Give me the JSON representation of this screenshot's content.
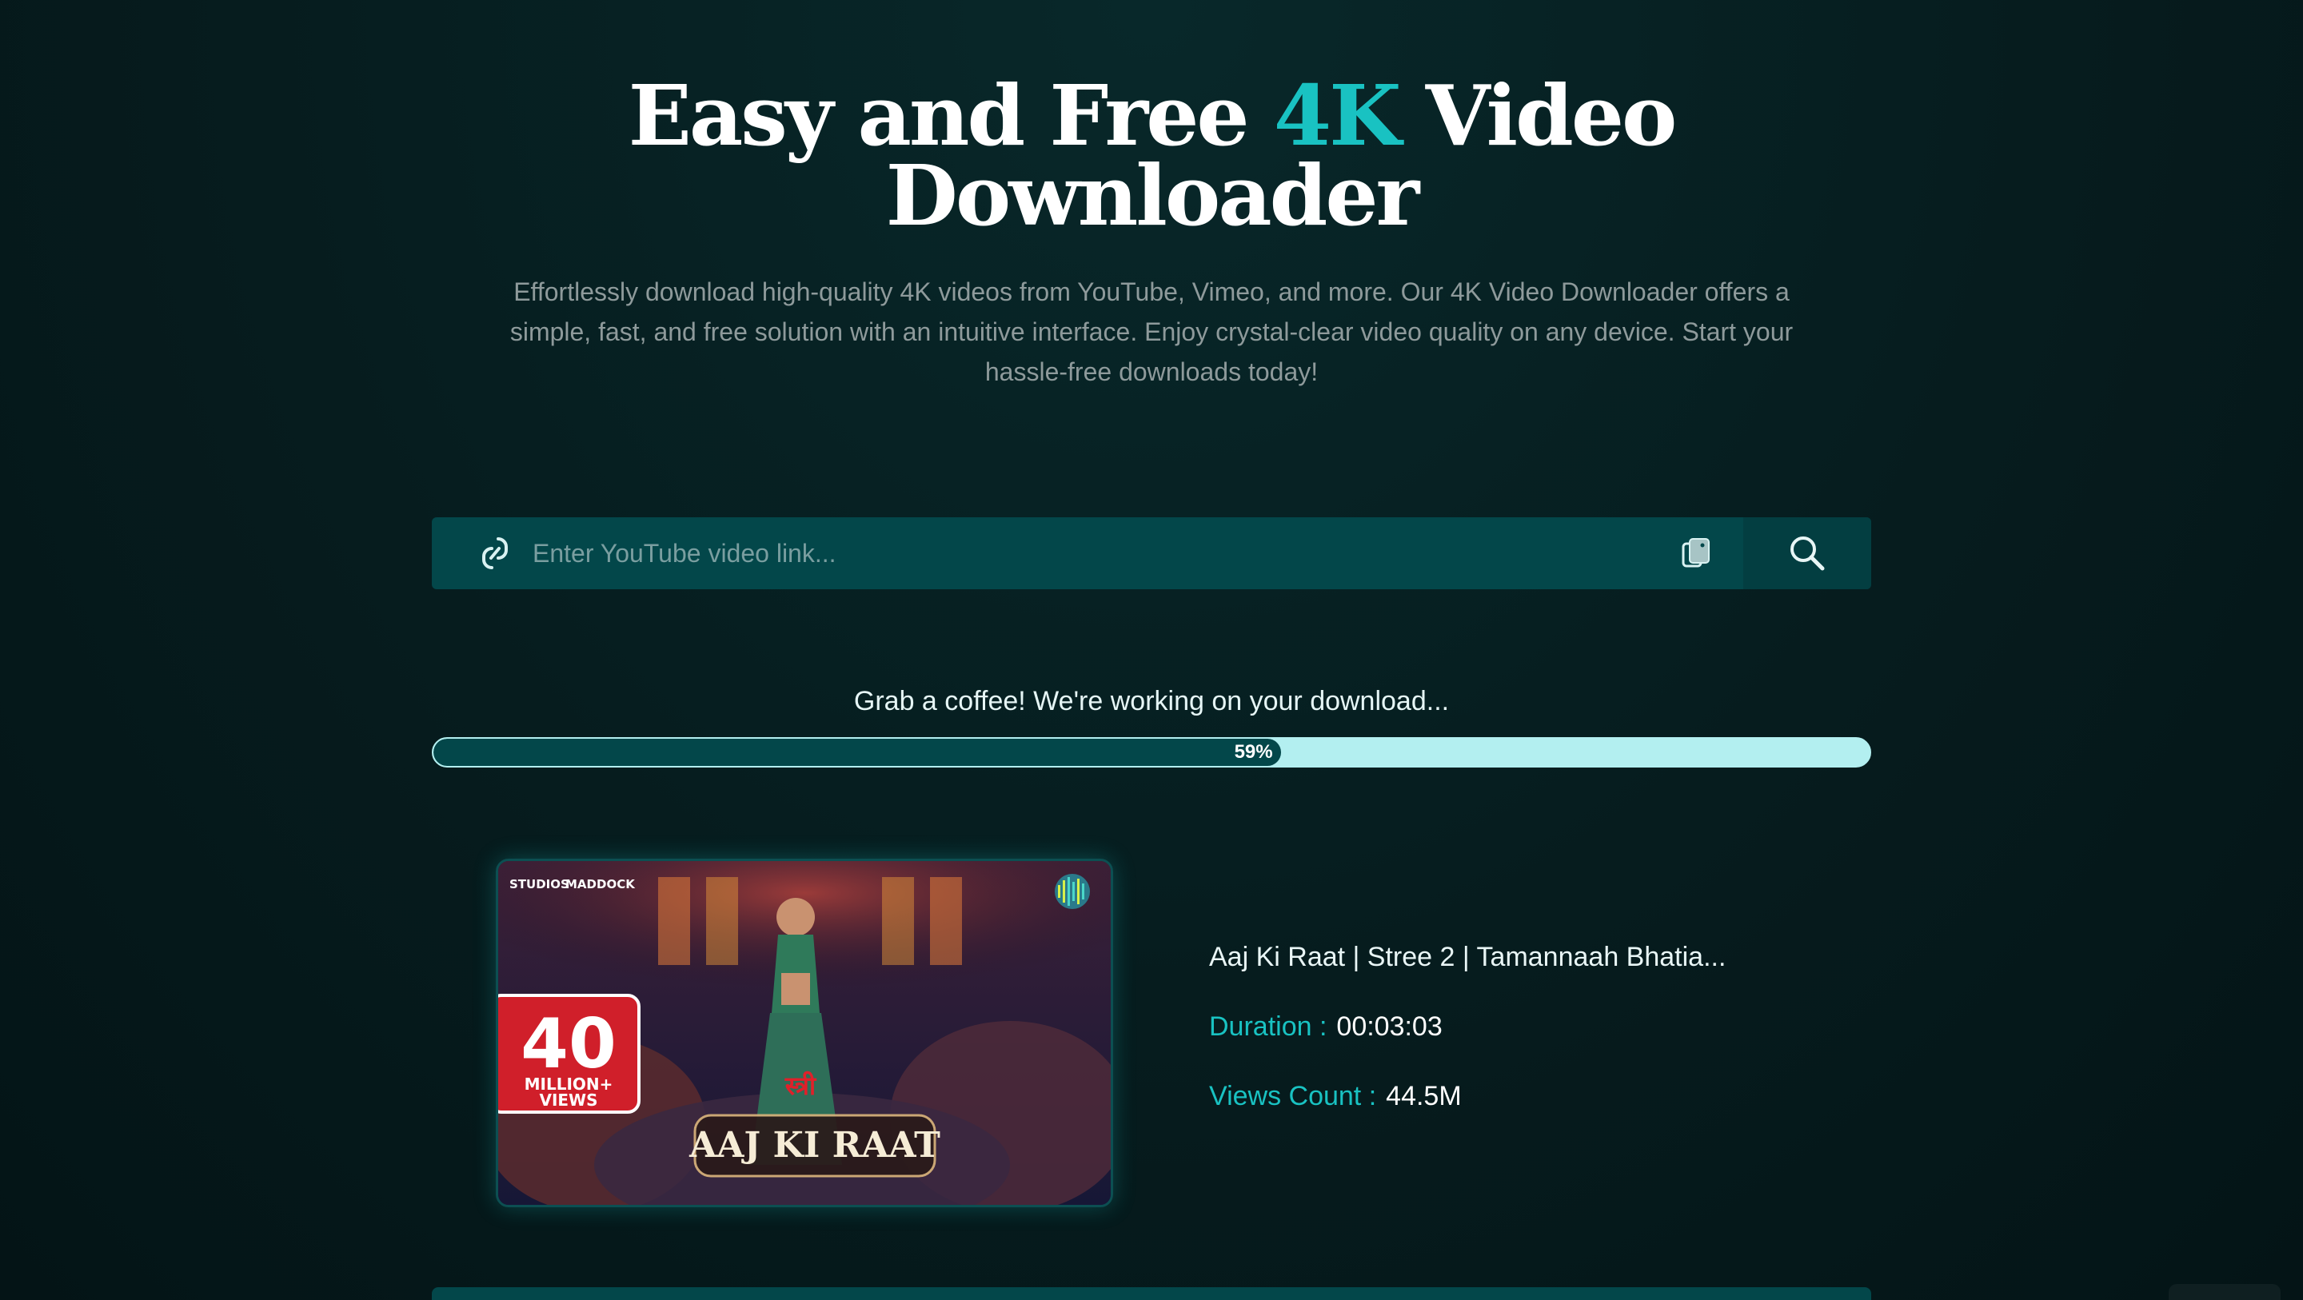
{
  "hero": {
    "title_part1": "Easy and Free ",
    "title_accent": "4K",
    "title_part2": " Video",
    "title_line2": "Downloader",
    "description": "Effortlessly download high-quality 4K videos from YouTube, Vimeo, and more. Our 4K Video Downloader offers a simple, fast, and free solution with an intuitive interface. Enjoy crystal-clear video quality on any device. Start your hassle-free downloads today!"
  },
  "search": {
    "placeholder": "Enter YouTube video link...",
    "value": "",
    "link_icon": "link-icon",
    "paste_icon": "paste-icon",
    "search_icon": "search-icon"
  },
  "download": {
    "status": "Grab a coffee! We're working on your download...",
    "progress_percent": 59,
    "progress_label": "59%"
  },
  "video": {
    "thumbnail": {
      "studio_logo": "STUDIOS",
      "partner_logo": "MADDOCK",
      "badge_number": "40",
      "badge_text_line1": "MILLION+",
      "badge_text_line2": "VIEWS",
      "title_art": "AAJ KI RAAT",
      "hindi_mark": "स्त्री"
    },
    "title": "Aaj Ki Raat | Stree 2 | Tamannaah Bhatia...",
    "duration_label": "Duration :",
    "duration_value": "00:03:03",
    "views_label": "Views Count :",
    "views_value": "44.5M"
  },
  "colors": {
    "accent": "#19c2c2",
    "bar": "#03474a",
    "track": "#b3eff0",
    "background": "#061c1e"
  }
}
